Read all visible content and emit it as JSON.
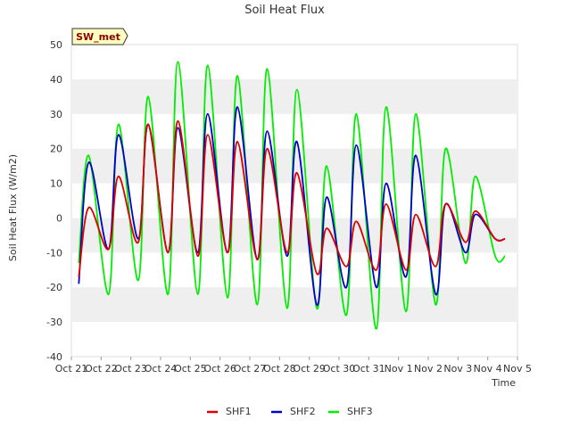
{
  "chart_data": {
    "type": "line",
    "title": "Soil Heat Flux",
    "xlabel": "Time",
    "ylabel": "Soil Heat Flux (W/m2)",
    "ylim": [
      -40,
      50
    ],
    "yticks": [
      -40,
      -30,
      -20,
      -10,
      0,
      10,
      20,
      30,
      40,
      50
    ],
    "ytick_labels": [
      "-40",
      "-30",
      "-20",
      "-10",
      "0",
      "10",
      "20",
      "30",
      "40",
      "50"
    ],
    "xlim": [
      "2023-10-21",
      "2023-11-05"
    ],
    "x_tick_labels": [
      "Oct 21",
      "Oct 22",
      "Oct 23",
      "Oct 24",
      "Oct 25",
      "Oct 26",
      "Oct 27",
      "Oct 28",
      "Oct 29",
      "Oct 30",
      "Oct 31",
      "Nov 1",
      "Nov 2",
      "Nov 3",
      "Nov 4",
      "Nov 5"
    ],
    "grid": "horizontal bands",
    "legend_position": "bottom",
    "badge": "SW_met",
    "x": [
      "2023-10-21 06:00",
      "2023-10-21 14:00",
      "2023-10-22 06:00",
      "2023-10-22 14:00",
      "2023-10-23 06:00",
      "2023-10-23 14:00",
      "2023-10-24 06:00",
      "2023-10-24 14:00",
      "2023-10-25 06:00",
      "2023-10-25 14:00",
      "2023-10-26 06:00",
      "2023-10-26 14:00",
      "2023-10-27 06:00",
      "2023-10-27 14:00",
      "2023-10-28 06:00",
      "2023-10-28 14:00",
      "2023-10-29 06:00",
      "2023-10-29 14:00",
      "2023-10-30 06:00",
      "2023-10-30 14:00",
      "2023-10-31 06:00",
      "2023-10-31 14:00",
      "2023-11-01 06:00",
      "2023-11-01 14:00",
      "2023-11-02 06:00",
      "2023-11-02 14:00",
      "2023-11-03 06:00",
      "2023-11-03 14:00",
      "2023-11-04 06:00",
      "2023-11-04 14:00"
    ],
    "series": [
      {
        "name": "SHF1",
        "color": "#dd0000",
        "values": [
          -17,
          3,
          -9,
          12,
          -7,
          27,
          -10,
          28,
          -11,
          24,
          -10,
          22,
          -12,
          20,
          -10,
          13,
          -16,
          -3,
          -14,
          -1,
          -15,
          4,
          -15,
          1,
          -14,
          4,
          -7,
          2,
          -6,
          -6
        ]
      },
      {
        "name": "SHF2",
        "color": "#0000cc",
        "values": [
          -19,
          16,
          -9,
          24,
          -6,
          27,
          -10,
          26,
          -10,
          30,
          -10,
          32,
          -12,
          25,
          -11,
          22,
          -25,
          6,
          -20,
          21,
          -20,
          10,
          -17,
          18,
          -22,
          4,
          -10,
          1,
          -6,
          -6
        ]
      },
      {
        "name": "SHF3",
        "color": "#00ee00",
        "values": [
          -13,
          18,
          -22,
          27,
          -18,
          35,
          -22,
          45,
          -22,
          44,
          -23,
          41,
          -25,
          43,
          -26,
          37,
          -26,
          15,
          -28,
          30,
          -32,
          32,
          -27,
          30,
          -25,
          20,
          -13,
          12,
          -11,
          -11
        ]
      }
    ]
  }
}
